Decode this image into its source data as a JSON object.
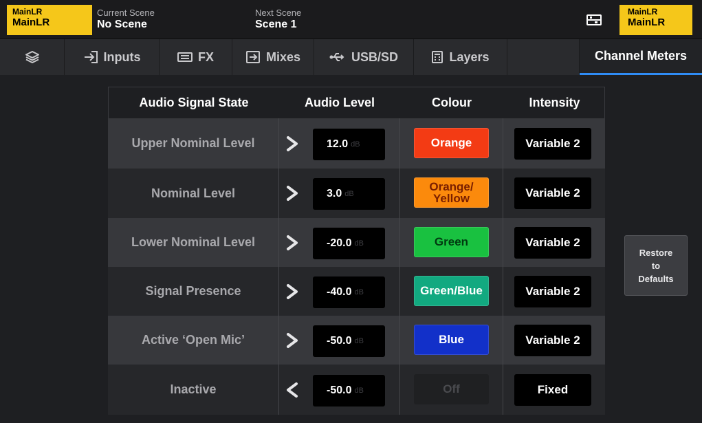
{
  "topbar": {
    "left_badge": {
      "line1": "MainLR",
      "line2": "MainLR"
    },
    "current_scene": {
      "label": "Current Scene",
      "value": "No Scene"
    },
    "next_scene": {
      "label": "Next Scene",
      "value": "Scene 1"
    },
    "storage_icon": "sd-card-icon",
    "right_badge": {
      "line1": "MainLR",
      "line2": "MainLR"
    }
  },
  "tabs": [
    {
      "label": "",
      "icon": "layers-stack-icon"
    },
    {
      "label": "Inputs",
      "icon": "input-arrow-icon"
    },
    {
      "label": "FX",
      "icon": "fx-icon"
    },
    {
      "label": "Mixes",
      "icon": "mix-arrow-icon"
    },
    {
      "label": "USB/SD",
      "icon": "usb-icon"
    },
    {
      "label": "Layers",
      "icon": "layers-grid-icon"
    },
    {
      "label": "",
      "icon": ""
    },
    {
      "label": "Channel Meters",
      "icon": "",
      "active": true
    }
  ],
  "table": {
    "headers": {
      "state": "Audio Signal State",
      "level": "Audio Level",
      "colour": "Colour",
      "intensity": "Intensity"
    },
    "rows": [
      {
        "state": "Upper Nominal Level",
        "direction": "greater",
        "level": "12.0",
        "unit": "dB",
        "colour": "Orange",
        "colour_bg": "#f33b14",
        "colour_fg": "#ffffff",
        "intensity": "Variable 2"
      },
      {
        "state": "Nominal Level",
        "direction": "greater",
        "level": "3.0",
        "unit": "dB",
        "colour": "Orange/ Yellow",
        "colour_bg": "#fb8a0c",
        "colour_fg": "#7a1f00",
        "intensity": "Variable 2"
      },
      {
        "state": "Lower Nominal Level",
        "direction": "greater",
        "level": "-20.0",
        "unit": "dB",
        "colour": "Green",
        "colour_bg": "#19c140",
        "colour_fg": "#003a10",
        "intensity": "Variable 2"
      },
      {
        "state": "Signal Presence",
        "direction": "greater",
        "level": "-40.0",
        "unit": "dB",
        "colour": "Green/Blue",
        "colour_bg": "#12a980",
        "colour_fg": "#ffffff",
        "intensity": "Variable 2"
      },
      {
        "state": "Active ‘Open Mic’",
        "direction": "greater",
        "level": "-50.0",
        "unit": "dB",
        "colour": "Blue",
        "colour_bg": "#1230c9",
        "colour_fg": "#ffffff",
        "intensity": "Variable 2"
      },
      {
        "state": "Inactive",
        "direction": "less",
        "level": "-50.0",
        "unit": "dB",
        "colour": "Off",
        "colour_bg": "#1f2022",
        "colour_fg": "#4a4b4f",
        "intensity": "Fixed"
      }
    ]
  },
  "restore_button": "Restore\nto\nDefaults"
}
